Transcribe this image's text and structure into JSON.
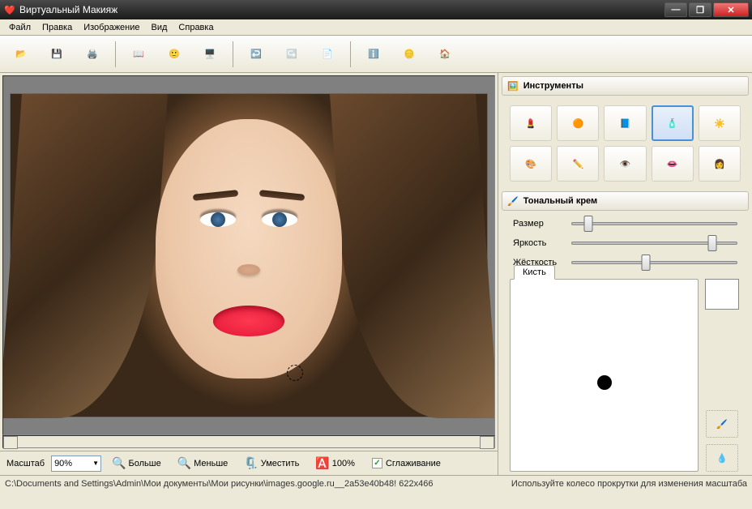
{
  "window": {
    "title": "Виртуальный Макияж"
  },
  "menu": [
    "Файл",
    "Правка",
    "Изображение",
    "Вид",
    "Справка"
  ],
  "tools_panel": {
    "title": "Инструменты",
    "items": [
      {
        "name": "lipstick-icon",
        "glyph": "💄"
      },
      {
        "name": "blush-icon",
        "glyph": "🟠"
      },
      {
        "name": "powder-icon",
        "glyph": "📘"
      },
      {
        "name": "foundation-icon",
        "glyph": "🧴",
        "selected": true
      },
      {
        "name": "sun-icon",
        "glyph": "☀️"
      },
      {
        "name": "eyeshadow-icon",
        "glyph": "🎨"
      },
      {
        "name": "pencil-icon",
        "glyph": "✏️"
      },
      {
        "name": "eye-icon",
        "glyph": "👁️"
      },
      {
        "name": "lips-icon",
        "glyph": "👄"
      },
      {
        "name": "hair-icon",
        "glyph": "👩"
      }
    ]
  },
  "current_tool": {
    "title": "Тональный крем",
    "sliders": [
      {
        "label": "Размер",
        "value": 10
      },
      {
        "label": "Яркость",
        "value": 85
      },
      {
        "label": "Жёсткость",
        "value": 45
      }
    ],
    "brush_tab": "Кисть"
  },
  "zoom": {
    "label": "Масштаб",
    "value": "90%",
    "more": "Больше",
    "less": "Меньше",
    "fit": "Уместить",
    "hundred": "100%",
    "smooth": "Сглаживание"
  },
  "status": {
    "path": "C:\\Documents and Settings\\Admin\\Мои документы\\Мои рисунки\\images.google.ru__2a53e40b48! 622x466",
    "hint": "Используйте колесо прокрутки для изменения масштаба"
  }
}
